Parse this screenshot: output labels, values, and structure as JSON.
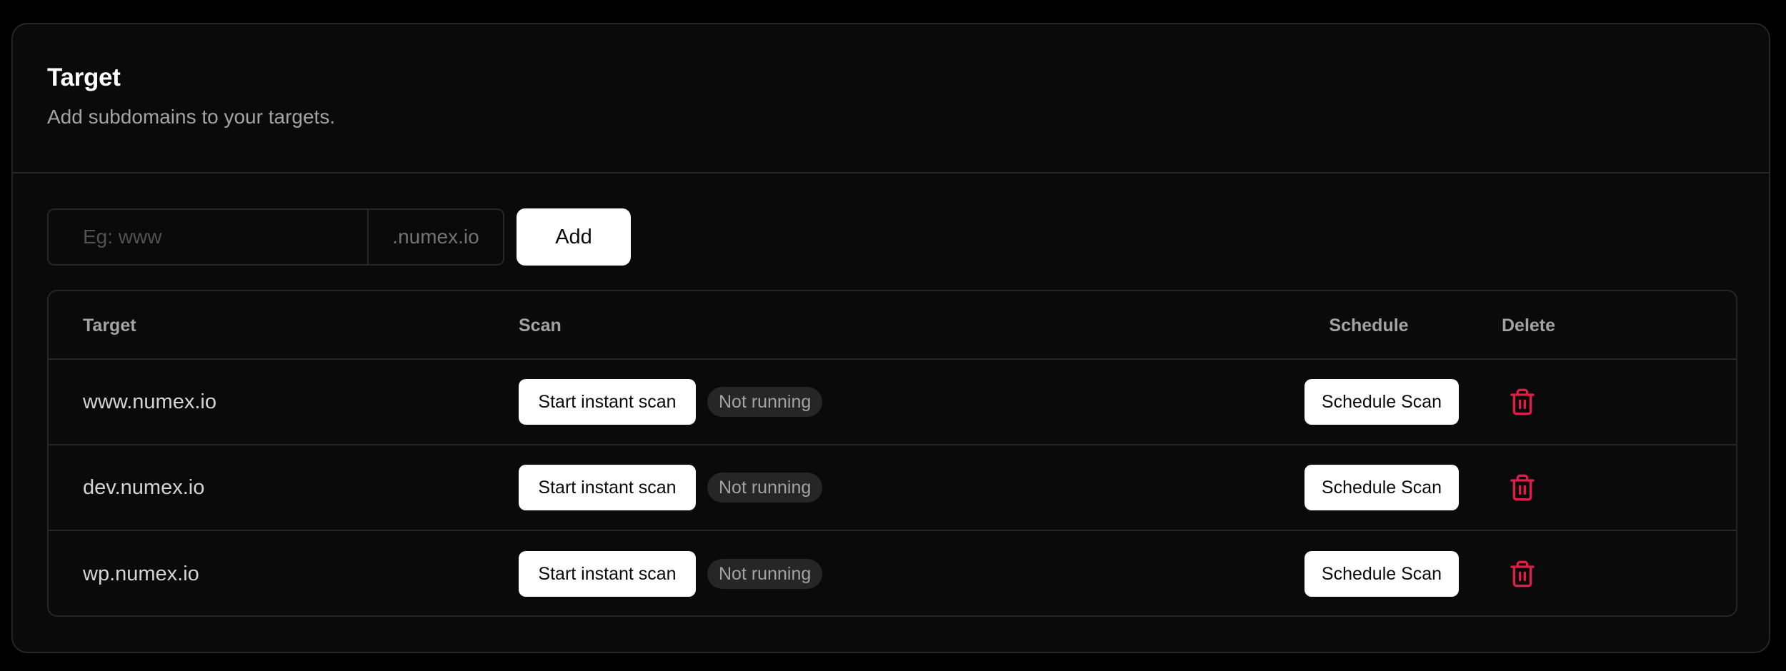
{
  "header": {
    "title": "Target",
    "description": "Add subdomains to your targets."
  },
  "form": {
    "placeholder": "Eg: www",
    "value": "",
    "suffix": ".numex.io",
    "add_label": "Add"
  },
  "table": {
    "columns": {
      "target": "Target",
      "scan": "Scan",
      "schedule": "Schedule",
      "delete": "Delete"
    },
    "rows": [
      {
        "target": "www.numex.io",
        "scan_label": "Start instant scan",
        "status": "Not running",
        "schedule_label": "Schedule Scan",
        "delete_icon": "trash-icon"
      },
      {
        "target": "dev.numex.io",
        "scan_label": "Start instant scan",
        "status": "Not running",
        "schedule_label": "Schedule Scan",
        "delete_icon": "trash-icon"
      },
      {
        "target": "wp.numex.io",
        "scan_label": "Start instant scan",
        "status": "Not running",
        "schedule_label": "Schedule Scan",
        "delete_icon": "trash-icon"
      }
    ]
  },
  "colors": {
    "background": "#000000",
    "card": "#0a0a0a",
    "border": "#262626",
    "delete_accent": "#e11d48"
  }
}
